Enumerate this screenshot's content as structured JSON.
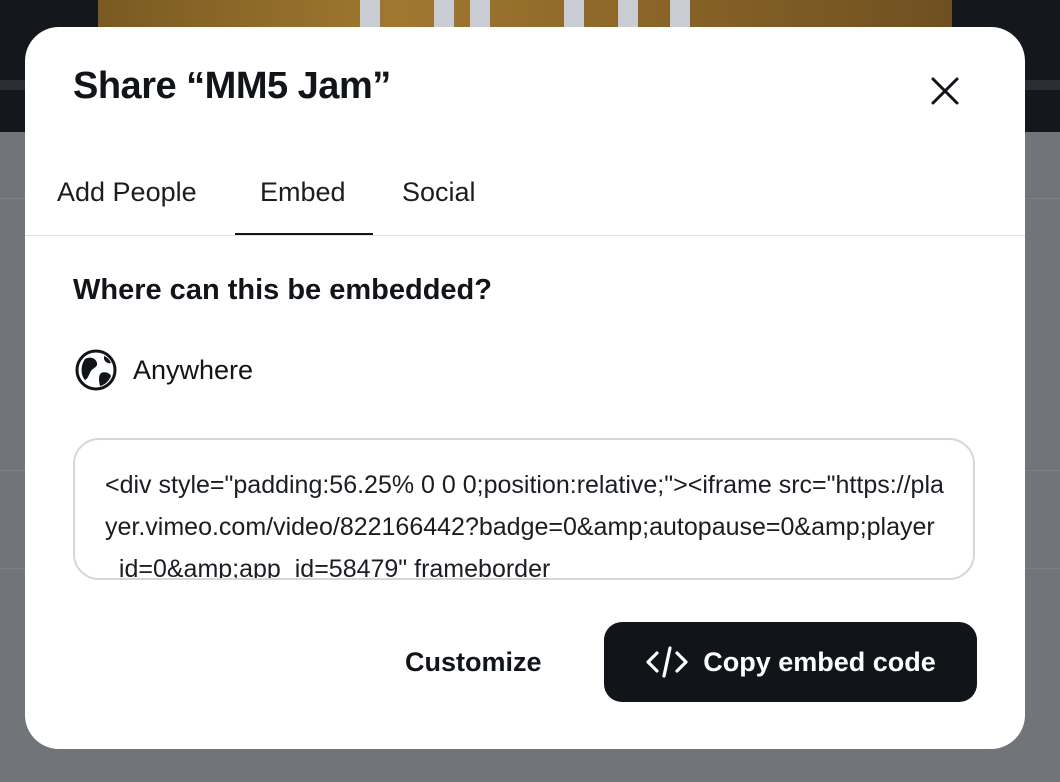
{
  "modal": {
    "title": "Share “MM5 Jam”",
    "tabs": [
      {
        "label": "Add People",
        "active": false
      },
      {
        "label": "Embed",
        "active": true
      },
      {
        "label": "Social",
        "active": false
      }
    ],
    "close_icon": "close-icon"
  },
  "embed": {
    "heading": "Where can this be embedded?",
    "privacy": {
      "icon": "globe-icon",
      "label": "Anywhere"
    },
    "code": "<div style=\"padding:56.25% 0 0 0;position:relative;\"><iframe src=\"https://player.vimeo.com/video/822166442?badge=0&amp;autopause=0&amp;player_id=0&amp;app_id=58479\" frameborder",
    "customize_label": "Customize",
    "copy_label": "Copy embed code",
    "copy_icon": "code-icon"
  },
  "colors": {
    "primary_button": "#111418",
    "overlay": "#6f7277",
    "text": "#111418"
  }
}
